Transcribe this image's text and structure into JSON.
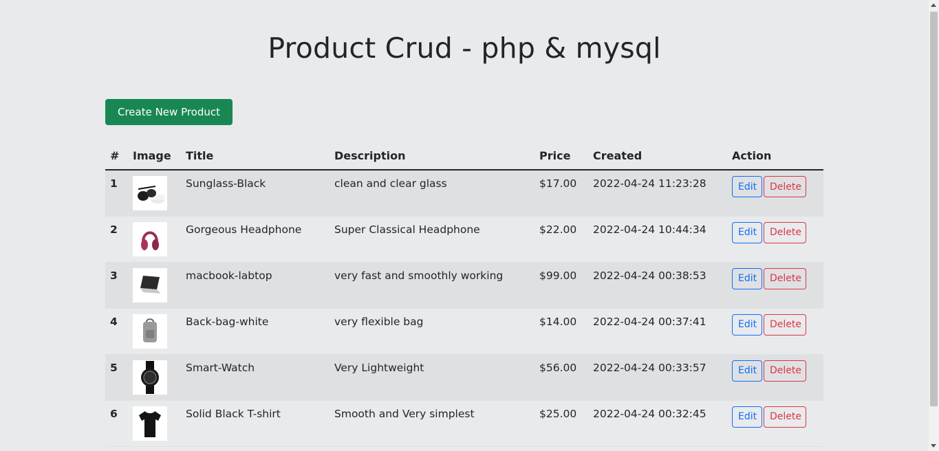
{
  "title": "Product Crud - php & mysql",
  "create_button": "Create New Product",
  "table": {
    "headers": [
      "#",
      "Image",
      "Title",
      "Description",
      "Price",
      "Created",
      "Action"
    ],
    "rows": [
      {
        "num": "1",
        "image": "sunglasses-image",
        "title": "Sunglass-Black",
        "description": "clean and clear glass",
        "price": "$17.00",
        "created": "2022-04-24 11:23:28"
      },
      {
        "num": "2",
        "image": "headphone-image",
        "title": "Gorgeous Headphone",
        "description": "Super Classical Headphone",
        "price": "$22.00",
        "created": "2022-04-24 10:44:34"
      },
      {
        "num": "3",
        "image": "laptop-image",
        "title": "macbook-labtop",
        "description": "very fast and smoothly working",
        "price": "$99.00",
        "created": "2022-04-24 00:38:53"
      },
      {
        "num": "4",
        "image": "backpack-image",
        "title": "Back-bag-white",
        "description": "very flexible bag",
        "price": "$14.00",
        "created": "2022-04-24 00:37:41"
      },
      {
        "num": "5",
        "image": "watch-image",
        "title": "Smart-Watch",
        "description": "Very Lightweight",
        "price": "$56.00",
        "created": "2022-04-24 00:33:57"
      },
      {
        "num": "6",
        "image": "tshirt-image",
        "title": "Solid Black T-shirt",
        "description": "Smooth and Very simplest",
        "price": "$25.00",
        "created": "2022-04-24 00:32:45"
      }
    ]
  },
  "actions": {
    "edit": "Edit",
    "delete": "Delete"
  },
  "colors": {
    "primary": "#0d6efd",
    "danger": "#dc3545",
    "success": "#198754",
    "background": "#e9eaec"
  }
}
